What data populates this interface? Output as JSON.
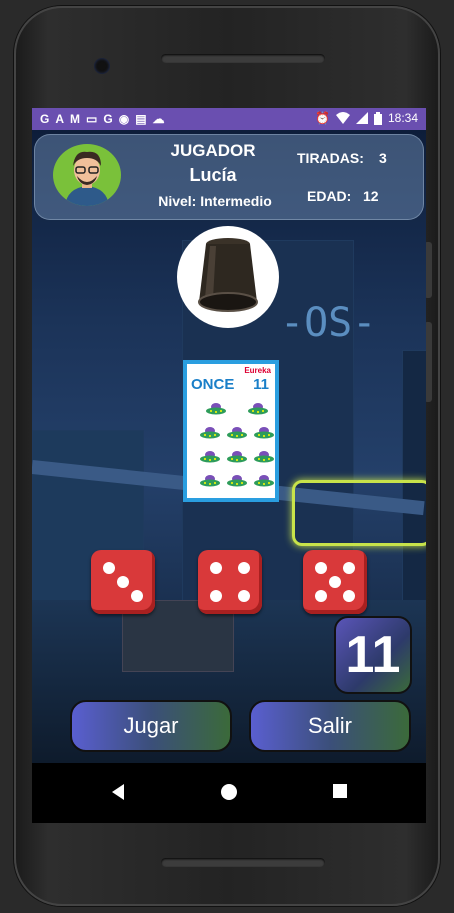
{
  "statusbar": {
    "left_icons": [
      "G",
      "A",
      "M",
      "▭",
      "G",
      "◉",
      "▤",
      "☁"
    ],
    "time": "18:34"
  },
  "player": {
    "title": "JUGADOR",
    "name": "Lucía",
    "level": "Nivel: Intermedio",
    "throws_label": "TIRADAS:",
    "throws_value": "3",
    "age_label": "EDAD:",
    "age_value": "12"
  },
  "card": {
    "brand": "Eureka",
    "word": "ONCE",
    "number": "11",
    "item_count": 11
  },
  "dice": [
    3,
    4,
    5
  ],
  "total": "11",
  "buttons": {
    "play": "Jugar",
    "exit": "Salir"
  },
  "colors": {
    "statusbar": "#6a4fb0",
    "dice": "#d9393a",
    "card_border": "#2a9ee0",
    "avatar_bg": "#7ac13a"
  }
}
